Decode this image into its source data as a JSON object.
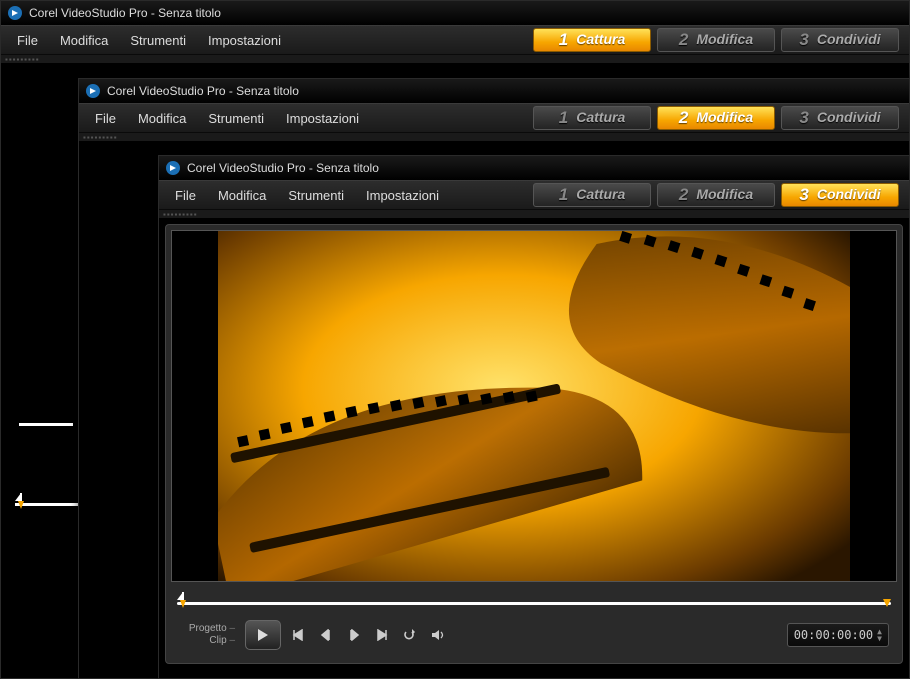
{
  "app_title": "Corel VideoStudio Pro - Senza titolo",
  "menu": {
    "file": "File",
    "modifica": "Modifica",
    "strumenti": "Strumenti",
    "impostazioni": "Impostazioni"
  },
  "steps": {
    "n1": "1",
    "l1": "Cattura",
    "n2": "2",
    "l2": "Modifica",
    "n3": "3",
    "l3": "Condividi"
  },
  "player": {
    "mode_project": "Progetto",
    "mode_clip": "Clip",
    "timecode": "00:00:00:00"
  },
  "active_step": {
    "win1": 1,
    "win2": 2,
    "win3": 3
  }
}
